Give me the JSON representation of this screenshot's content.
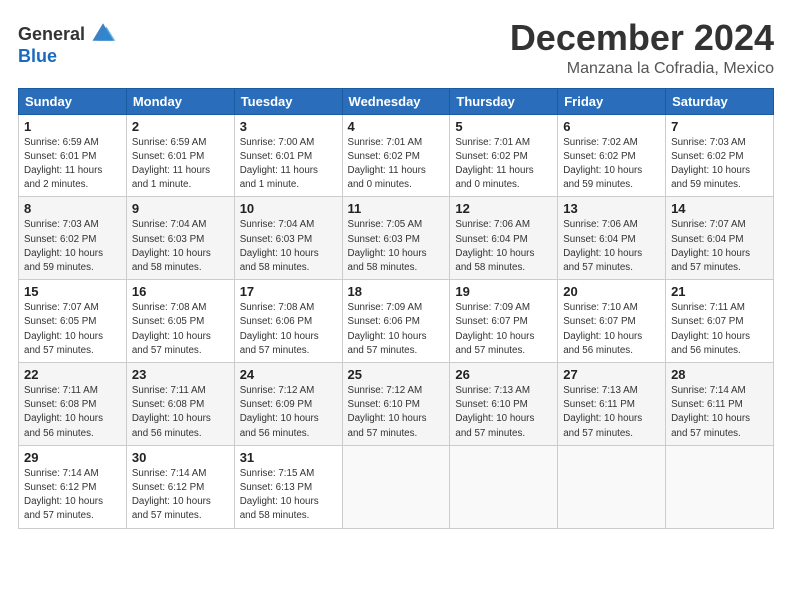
{
  "logo": {
    "general": "General",
    "blue": "Blue"
  },
  "title": "December 2024",
  "location": "Manzana la Cofradia, Mexico",
  "days_of_week": [
    "Sunday",
    "Monday",
    "Tuesday",
    "Wednesday",
    "Thursday",
    "Friday",
    "Saturday"
  ],
  "weeks": [
    [
      {
        "day": "1",
        "sunrise": "6:59 AM",
        "sunset": "6:01 PM",
        "daylight": "11 hours and 2 minutes."
      },
      {
        "day": "2",
        "sunrise": "6:59 AM",
        "sunset": "6:01 PM",
        "daylight": "11 hours and 1 minute."
      },
      {
        "day": "3",
        "sunrise": "7:00 AM",
        "sunset": "6:01 PM",
        "daylight": "11 hours and 1 minute."
      },
      {
        "day": "4",
        "sunrise": "7:01 AM",
        "sunset": "6:02 PM",
        "daylight": "11 hours and 0 minutes."
      },
      {
        "day": "5",
        "sunrise": "7:01 AM",
        "sunset": "6:02 PM",
        "daylight": "11 hours and 0 minutes."
      },
      {
        "day": "6",
        "sunrise": "7:02 AM",
        "sunset": "6:02 PM",
        "daylight": "10 hours and 59 minutes."
      },
      {
        "day": "7",
        "sunrise": "7:03 AM",
        "sunset": "6:02 PM",
        "daylight": "10 hours and 59 minutes."
      }
    ],
    [
      {
        "day": "8",
        "sunrise": "7:03 AM",
        "sunset": "6:02 PM",
        "daylight": "10 hours and 59 minutes."
      },
      {
        "day": "9",
        "sunrise": "7:04 AM",
        "sunset": "6:03 PM",
        "daylight": "10 hours and 58 minutes."
      },
      {
        "day": "10",
        "sunrise": "7:04 AM",
        "sunset": "6:03 PM",
        "daylight": "10 hours and 58 minutes."
      },
      {
        "day": "11",
        "sunrise": "7:05 AM",
        "sunset": "6:03 PM",
        "daylight": "10 hours and 58 minutes."
      },
      {
        "day": "12",
        "sunrise": "7:06 AM",
        "sunset": "6:04 PM",
        "daylight": "10 hours and 58 minutes."
      },
      {
        "day": "13",
        "sunrise": "7:06 AM",
        "sunset": "6:04 PM",
        "daylight": "10 hours and 57 minutes."
      },
      {
        "day": "14",
        "sunrise": "7:07 AM",
        "sunset": "6:04 PM",
        "daylight": "10 hours and 57 minutes."
      }
    ],
    [
      {
        "day": "15",
        "sunrise": "7:07 AM",
        "sunset": "6:05 PM",
        "daylight": "10 hours and 57 minutes."
      },
      {
        "day": "16",
        "sunrise": "7:08 AM",
        "sunset": "6:05 PM",
        "daylight": "10 hours and 57 minutes."
      },
      {
        "day": "17",
        "sunrise": "7:08 AM",
        "sunset": "6:06 PM",
        "daylight": "10 hours and 57 minutes."
      },
      {
        "day": "18",
        "sunrise": "7:09 AM",
        "sunset": "6:06 PM",
        "daylight": "10 hours and 57 minutes."
      },
      {
        "day": "19",
        "sunrise": "7:09 AM",
        "sunset": "6:07 PM",
        "daylight": "10 hours and 57 minutes."
      },
      {
        "day": "20",
        "sunrise": "7:10 AM",
        "sunset": "6:07 PM",
        "daylight": "10 hours and 56 minutes."
      },
      {
        "day": "21",
        "sunrise": "7:11 AM",
        "sunset": "6:07 PM",
        "daylight": "10 hours and 56 minutes."
      }
    ],
    [
      {
        "day": "22",
        "sunrise": "7:11 AM",
        "sunset": "6:08 PM",
        "daylight": "10 hours and 56 minutes."
      },
      {
        "day": "23",
        "sunrise": "7:11 AM",
        "sunset": "6:08 PM",
        "daylight": "10 hours and 56 minutes."
      },
      {
        "day": "24",
        "sunrise": "7:12 AM",
        "sunset": "6:09 PM",
        "daylight": "10 hours and 56 minutes."
      },
      {
        "day": "25",
        "sunrise": "7:12 AM",
        "sunset": "6:10 PM",
        "daylight": "10 hours and 57 minutes."
      },
      {
        "day": "26",
        "sunrise": "7:13 AM",
        "sunset": "6:10 PM",
        "daylight": "10 hours and 57 minutes."
      },
      {
        "day": "27",
        "sunrise": "7:13 AM",
        "sunset": "6:11 PM",
        "daylight": "10 hours and 57 minutes."
      },
      {
        "day": "28",
        "sunrise": "7:14 AM",
        "sunset": "6:11 PM",
        "daylight": "10 hours and 57 minutes."
      }
    ],
    [
      {
        "day": "29",
        "sunrise": "7:14 AM",
        "sunset": "6:12 PM",
        "daylight": "10 hours and 57 minutes."
      },
      {
        "day": "30",
        "sunrise": "7:14 AM",
        "sunset": "6:12 PM",
        "daylight": "10 hours and 57 minutes."
      },
      {
        "day": "31",
        "sunrise": "7:15 AM",
        "sunset": "6:13 PM",
        "daylight": "10 hours and 58 minutes."
      },
      null,
      null,
      null,
      null
    ]
  ]
}
